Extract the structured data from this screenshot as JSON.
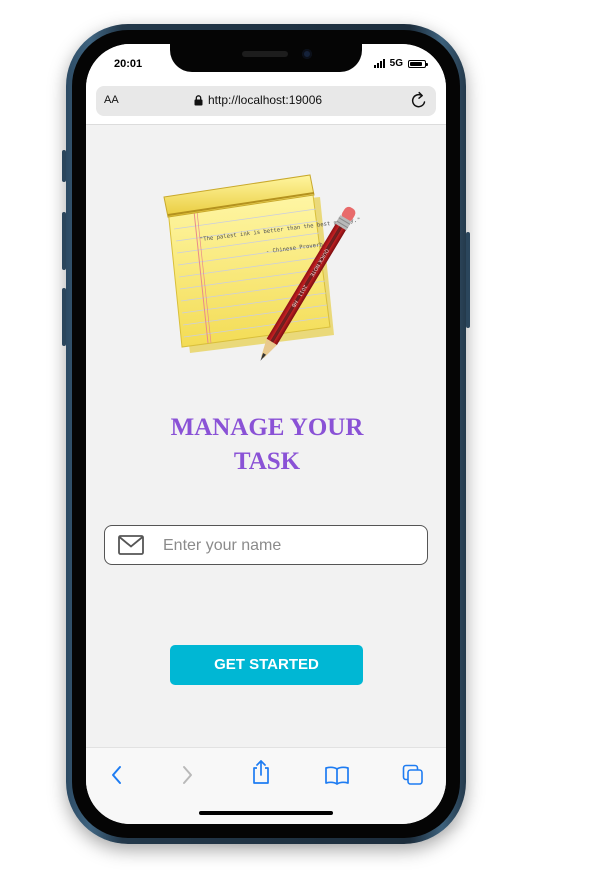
{
  "status_bar": {
    "time": "20:01",
    "network": "5G",
    "battery_level": 0.85
  },
  "browser": {
    "text_size_label": "AA",
    "url": "http://localhost:19006",
    "toolbar": {
      "back_icon": "chevron-left-icon",
      "forward_icon": "chevron-right-icon",
      "share_icon": "share-icon",
      "bookmarks_icon": "book-icon",
      "tabs_icon": "tabs-icon"
    }
  },
  "hero": {
    "note_quote": "\"The palest ink is better than the best memory.\"",
    "note_attribution": "- Chinese Proverb",
    "pencil_label": "QUICK NOTE",
    "pencil_year": "2011",
    "pencil_grade": "HB"
  },
  "app": {
    "title_line1": "MANAGE YOUR",
    "title_line2": "TASK",
    "name_input": {
      "placeholder": "Enter your name",
      "value": "",
      "icon": "mail-icon"
    },
    "get_started_label": "GET STARTED"
  },
  "colors": {
    "accent": "#00b7d4",
    "title": "#8a52d6",
    "ios_blue": "#1e7cf2"
  }
}
